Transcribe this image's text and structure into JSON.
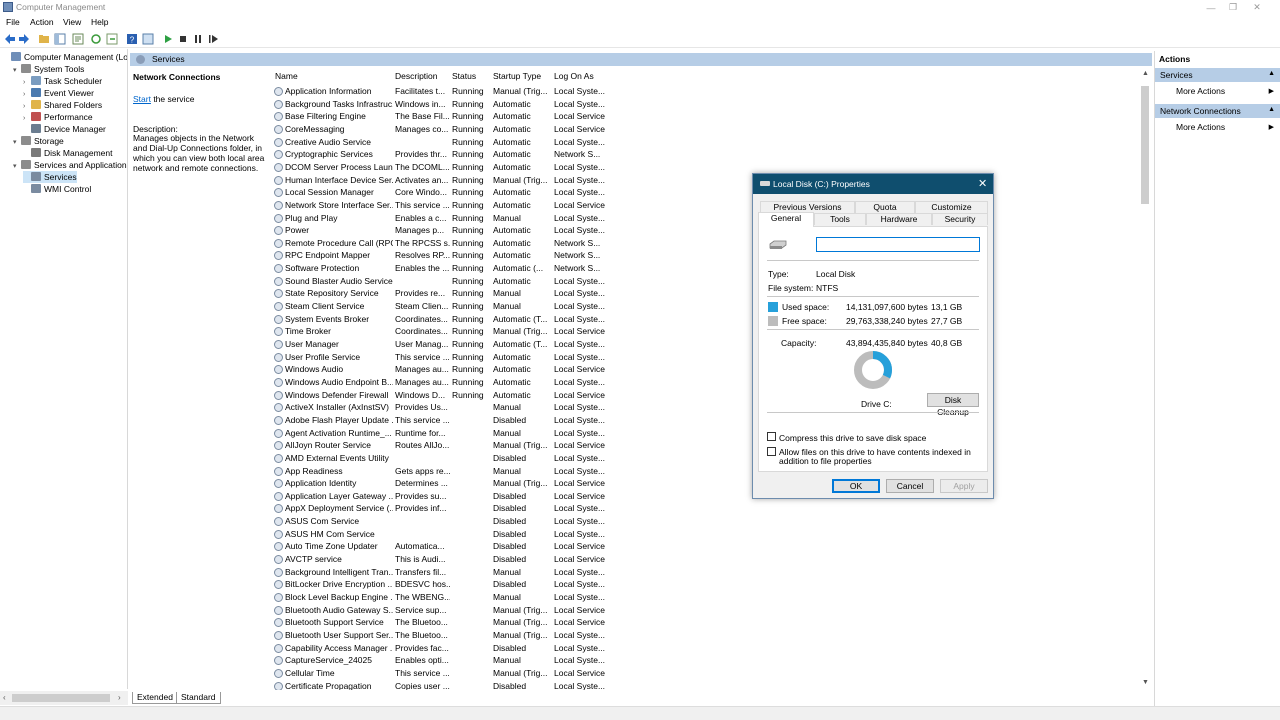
{
  "window": {
    "title": "Computer Management"
  },
  "menu": [
    "File",
    "Action",
    "View",
    "Help"
  ],
  "tree": [
    {
      "label": "Computer Management (Local",
      "level": 0,
      "twisty": "",
      "icon": "computer-icon",
      "color": "#6f8eb8"
    },
    {
      "label": "System Tools",
      "level": 1,
      "twisty": "▾",
      "icon": "tools-icon",
      "color": "#8c8c8c"
    },
    {
      "label": "Task Scheduler",
      "level": 2,
      "twisty": "›",
      "icon": "clock-icon",
      "color": "#7a9cc0"
    },
    {
      "label": "Event Viewer",
      "level": 2,
      "twisty": "›",
      "icon": "event-viewer-icon",
      "color": "#4a7ab0"
    },
    {
      "label": "Shared Folders",
      "level": 2,
      "twisty": "›",
      "icon": "folder-icon",
      "color": "#e0b44a"
    },
    {
      "label": "Performance",
      "level": 2,
      "twisty": "›",
      "icon": "performance-icon",
      "color": "#c05050"
    },
    {
      "label": "Device Manager",
      "level": 2,
      "twisty": "",
      "icon": "device-manager-icon",
      "color": "#6b7d90"
    },
    {
      "label": "Storage",
      "level": 1,
      "twisty": "▾",
      "icon": "storage-icon",
      "color": "#8c8c8c"
    },
    {
      "label": "Disk Management",
      "level": 2,
      "twisty": "",
      "icon": "disk-icon",
      "color": "#7a7a7a"
    },
    {
      "label": "Services and Applications",
      "level": 1,
      "twisty": "▾",
      "icon": "services-apps-icon",
      "color": "#8c8c8c"
    },
    {
      "label": "Services",
      "level": 2,
      "twisty": "",
      "icon": "gear-icon",
      "color": "#7a8ba0",
      "selected": true
    },
    {
      "label": "WMI Control",
      "level": 2,
      "twisty": "",
      "icon": "wmi-icon",
      "color": "#7a8ba0"
    }
  ],
  "center": {
    "header": "Services",
    "desc": {
      "title": "Network Connections",
      "start_link": "Start",
      "start_rest": " the service",
      "desc_label": "Description:",
      "desc_text": "Manages objects in the Network and Dial-Up Connections folder, in which you can view both local area network and remote connections."
    },
    "columns": [
      "Name",
      "Description",
      "Status",
      "Startup Type",
      "Log On As"
    ],
    "rows": [
      [
        "Application Information",
        "Facilitates t...",
        "Running",
        "Manual (Trig...",
        "Local Syste..."
      ],
      [
        "Background Tasks Infrastruc...",
        "Windows in...",
        "Running",
        "Automatic",
        "Local Syste..."
      ],
      [
        "Base Filtering Engine",
        "The Base Fil...",
        "Running",
        "Automatic",
        "Local Service"
      ],
      [
        "CoreMessaging",
        "Manages co...",
        "Running",
        "Automatic",
        "Local Service"
      ],
      [
        "Creative Audio Service",
        "",
        "Running",
        "Automatic",
        "Local Syste..."
      ],
      [
        "Cryptographic Services",
        "Provides thr...",
        "Running",
        "Automatic",
        "Network S..."
      ],
      [
        "DCOM Server Process Laun...",
        "The DCOML...",
        "Running",
        "Automatic",
        "Local Syste..."
      ],
      [
        "Human Interface Device Ser...",
        "Activates an...",
        "Running",
        "Manual (Trig...",
        "Local Syste..."
      ],
      [
        "Local Session Manager",
        "Core Windo...",
        "Running",
        "Automatic",
        "Local Syste..."
      ],
      [
        "Network Store Interface Ser...",
        "This service ...",
        "Running",
        "Automatic",
        "Local Service"
      ],
      [
        "Plug and Play",
        "Enables a c...",
        "Running",
        "Manual",
        "Local Syste..."
      ],
      [
        "Power",
        "Manages p...",
        "Running",
        "Automatic",
        "Local Syste..."
      ],
      [
        "Remote Procedure Call (RPC)",
        "The RPCSS s...",
        "Running",
        "Automatic",
        "Network S..."
      ],
      [
        "RPC Endpoint Mapper",
        "Resolves RP...",
        "Running",
        "Automatic",
        "Network S..."
      ],
      [
        "Software Protection",
        "Enables the ...",
        "Running",
        "Automatic (...",
        "Network S..."
      ],
      [
        "Sound Blaster Audio Service",
        "",
        "Running",
        "Automatic",
        "Local Syste..."
      ],
      [
        "State Repository Service",
        "Provides re...",
        "Running",
        "Manual",
        "Local Syste..."
      ],
      [
        "Steam Client Service",
        "Steam Clien...",
        "Running",
        "Manual",
        "Local Syste..."
      ],
      [
        "System Events Broker",
        "Coordinates...",
        "Running",
        "Automatic (T...",
        "Local Syste..."
      ],
      [
        "Time Broker",
        "Coordinates...",
        "Running",
        "Manual (Trig...",
        "Local Service"
      ],
      [
        "User Manager",
        "User Manag...",
        "Running",
        "Automatic (T...",
        "Local Syste..."
      ],
      [
        "User Profile Service",
        "This service ...",
        "Running",
        "Automatic",
        "Local Syste..."
      ],
      [
        "Windows Audio",
        "Manages au...",
        "Running",
        "Automatic",
        "Local Service"
      ],
      [
        "Windows Audio Endpoint B...",
        "Manages au...",
        "Running",
        "Automatic",
        "Local Syste..."
      ],
      [
        "Windows Defender Firewall",
        "Windows D...",
        "Running",
        "Automatic",
        "Local Service"
      ],
      [
        "ActiveX Installer (AxInstSV)",
        "Provides Us...",
        "",
        "Manual",
        "Local Syste..."
      ],
      [
        "Adobe Flash Player Update ...",
        "This service ...",
        "",
        "Disabled",
        "Local Syste..."
      ],
      [
        "Agent Activation Runtime_...",
        "Runtime for...",
        "",
        "Manual",
        "Local Syste..."
      ],
      [
        "AllJoyn Router Service",
        "Routes AllJo...",
        "",
        "Manual (Trig...",
        "Local Service"
      ],
      [
        "AMD External Events Utility",
        "",
        "",
        "Disabled",
        "Local Syste..."
      ],
      [
        "App Readiness",
        "Gets apps re...",
        "",
        "Manual",
        "Local Syste..."
      ],
      [
        "Application Identity",
        "Determines ...",
        "",
        "Manual (Trig...",
        "Local Service"
      ],
      [
        "Application Layer Gateway ...",
        "Provides su...",
        "",
        "Disabled",
        "Local Service"
      ],
      [
        "AppX Deployment Service (...",
        "Provides inf...",
        "",
        "Disabled",
        "Local Syste..."
      ],
      [
        "ASUS Com Service",
        "",
        "",
        "Disabled",
        "Local Syste..."
      ],
      [
        "ASUS HM Com Service",
        "",
        "",
        "Disabled",
        "Local Syste..."
      ],
      [
        "Auto Time Zone Updater",
        "Automatica...",
        "",
        "Disabled",
        "Local Service"
      ],
      [
        "AVCTP service",
        "This is Audi...",
        "",
        "Disabled",
        "Local Service"
      ],
      [
        "Background Intelligent Tran...",
        "Transfers fil...",
        "",
        "Manual",
        "Local Syste..."
      ],
      [
        "BitLocker Drive Encryption ...",
        "BDESVC hos...",
        "",
        "Disabled",
        "Local Syste..."
      ],
      [
        "Block Level Backup Engine ...",
        "The WBENG...",
        "",
        "Manual",
        "Local Syste..."
      ],
      [
        "Bluetooth Audio Gateway S...",
        "Service sup...",
        "",
        "Manual (Trig...",
        "Local Service"
      ],
      [
        "Bluetooth Support Service",
        "The Bluetoo...",
        "",
        "Manual (Trig...",
        "Local Service"
      ],
      [
        "Bluetooth User Support Ser...",
        "The Bluetoo...",
        "",
        "Manual (Trig...",
        "Local Syste..."
      ],
      [
        "Capability Access Manager ...",
        "Provides fac...",
        "",
        "Disabled",
        "Local Syste..."
      ],
      [
        "CaptureService_24025",
        "Enables opti...",
        "",
        "Manual",
        "Local Syste..."
      ],
      [
        "Cellular Time",
        "This service ...",
        "",
        "Manual (Trig...",
        "Local Service"
      ],
      [
        "Certificate Propagation",
        "Copies user ...",
        "",
        "Disabled",
        "Local Syste..."
      ]
    ],
    "bottom_tabs": [
      "Extended",
      "Standard"
    ]
  },
  "actions": {
    "title": "Actions",
    "sections": [
      {
        "header": "Services",
        "item": "More Actions"
      },
      {
        "header": "Network Connections",
        "item": "More Actions"
      }
    ]
  },
  "dialog": {
    "title": "Local Disk (C:) Properties",
    "tabs_top": [
      "Previous Versions",
      "Quota",
      "Customize"
    ],
    "tabs_bottom": [
      "General",
      "Tools",
      "Hardware",
      "Security"
    ],
    "name_value": "",
    "type_label": "Type:",
    "type_value": "Local Disk",
    "fs_label": "File system:",
    "fs_value": "NTFS",
    "used_label": "Used space:",
    "used_bytes": "14,131,097,600 bytes",
    "used_gb": "13,1 GB",
    "free_label": "Free space:",
    "free_bytes": "29,763,338,240 bytes",
    "free_gb": "27,7 GB",
    "cap_label": "Capacity:",
    "cap_bytes": "43,894,435,840 bytes",
    "cap_gb": "40,8 GB",
    "used_fraction": 0.322,
    "drive_label": "Drive C:",
    "cleanup_label": "Disk Cleanup",
    "compress_label": "Compress this drive to save disk space",
    "index_label": "Allow files on this drive to have contents indexed in addition to file properties",
    "ok": "OK",
    "cancel": "Cancel",
    "apply": "Apply",
    "colors": {
      "used": "#26a0da",
      "free": "#bcbcbc",
      "title_bar": "#0f4e6e"
    }
  }
}
